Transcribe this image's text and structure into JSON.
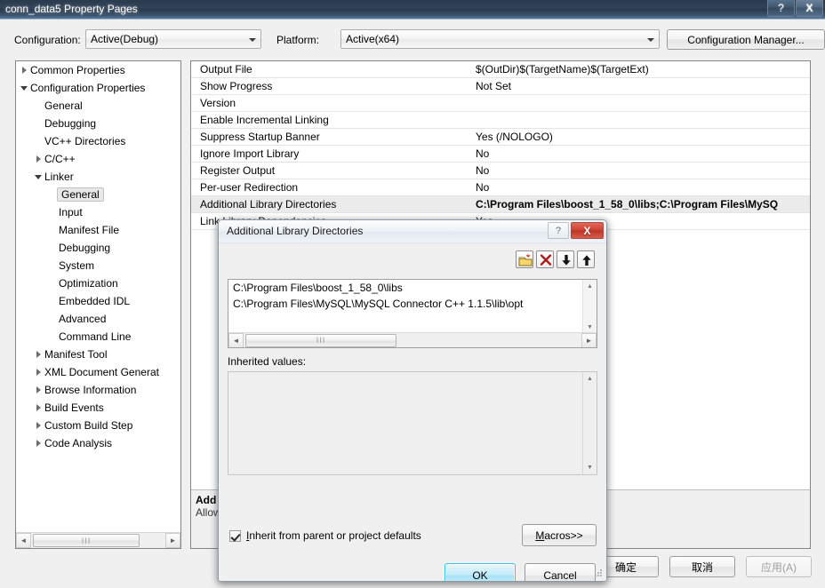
{
  "window": {
    "title": "conn_data5 Property Pages",
    "help_btn": "?",
    "close_btn": "X"
  },
  "configbar": {
    "configuration_label": "Configuration:",
    "configuration_value": "Active(Debug)",
    "platform_label": "Platform:",
    "platform_value": "Active(x64)",
    "config_manager_label": "Configuration Manager..."
  },
  "tree": {
    "nodes": [
      {
        "label": "Common Properties",
        "indent": 0,
        "toggle": "collapsed",
        "selected": false
      },
      {
        "label": "Configuration Properties",
        "indent": 0,
        "toggle": "expanded",
        "selected": false
      },
      {
        "label": "General",
        "indent": 1,
        "toggle": "none",
        "selected": false
      },
      {
        "label": "Debugging",
        "indent": 1,
        "toggle": "none",
        "selected": false
      },
      {
        "label": "VC++ Directories",
        "indent": 1,
        "toggle": "none",
        "selected": false
      },
      {
        "label": "C/C++",
        "indent": 1,
        "toggle": "collapsed",
        "selected": false
      },
      {
        "label": "Linker",
        "indent": 1,
        "toggle": "expanded",
        "selected": false
      },
      {
        "label": "General",
        "indent": 2,
        "toggle": "none",
        "selected": true
      },
      {
        "label": "Input",
        "indent": 2,
        "toggle": "none",
        "selected": false
      },
      {
        "label": "Manifest File",
        "indent": 2,
        "toggle": "none",
        "selected": false
      },
      {
        "label": "Debugging",
        "indent": 2,
        "toggle": "none",
        "selected": false
      },
      {
        "label": "System",
        "indent": 2,
        "toggle": "none",
        "selected": false
      },
      {
        "label": "Optimization",
        "indent": 2,
        "toggle": "none",
        "selected": false
      },
      {
        "label": "Embedded IDL",
        "indent": 2,
        "toggle": "none",
        "selected": false
      },
      {
        "label": "Advanced",
        "indent": 2,
        "toggle": "none",
        "selected": false
      },
      {
        "label": "Command Line",
        "indent": 2,
        "toggle": "none",
        "selected": false
      },
      {
        "label": "Manifest Tool",
        "indent": 1,
        "toggle": "collapsed",
        "selected": false
      },
      {
        "label": "XML Document Generat",
        "indent": 1,
        "toggle": "collapsed",
        "selected": false
      },
      {
        "label": "Browse Information",
        "indent": 1,
        "toggle": "collapsed",
        "selected": false
      },
      {
        "label": "Build Events",
        "indent": 1,
        "toggle": "collapsed",
        "selected": false
      },
      {
        "label": "Custom Build Step",
        "indent": 1,
        "toggle": "collapsed",
        "selected": false
      },
      {
        "label": "Code Analysis",
        "indent": 1,
        "toggle": "collapsed",
        "selected": false
      }
    ],
    "scroll_left_arrow": "◄",
    "scroll_right_arrow": "►",
    "scroll_thumb_grip": "III"
  },
  "grid": {
    "rows": [
      {
        "name": "Output File",
        "value": "$(OutDir)$(TargetName)$(TargetExt)",
        "highlight": false
      },
      {
        "name": "Show Progress",
        "value": "Not Set",
        "highlight": false
      },
      {
        "name": "Version",
        "value": "",
        "highlight": false
      },
      {
        "name": "Enable Incremental Linking",
        "value": "",
        "highlight": false
      },
      {
        "name": "Suppress Startup Banner",
        "value": "Yes (/NOLOGO)",
        "highlight": false
      },
      {
        "name": "Ignore Import Library",
        "value": "No",
        "highlight": false
      },
      {
        "name": "Register Output",
        "value": "No",
        "highlight": false
      },
      {
        "name": "Per-user Redirection",
        "value": "No",
        "highlight": false
      },
      {
        "name": "Additional Library Directories",
        "value": "C:\\Program Files\\boost_1_58_0\\libs;C:\\Program Files\\MySQ",
        "highlight": true
      },
      {
        "name": "Link Library Dependencies",
        "value": "Yes",
        "highlight": false
      }
    ],
    "description_title": "Add",
    "description_body": "Allow"
  },
  "main_buttons": {
    "ok": "确定",
    "cancel": "取消",
    "apply": "应用(A)"
  },
  "dialog": {
    "title": "Additional Library Directories",
    "help_btn": "?",
    "close_btn": "X",
    "toolbar": [
      {
        "name": "new-folder-icon",
        "tooltip": "New Line"
      },
      {
        "name": "delete-x-icon",
        "tooltip": "Delete"
      },
      {
        "name": "arrow-down-icon",
        "tooltip": "Move Down"
      },
      {
        "name": "arrow-up-icon",
        "tooltip": "Move Up"
      }
    ],
    "paths": [
      "C:\\Program Files\\boost_1_58_0\\libs",
      "C:\\Program Files\\MySQL\\MySQL Connector C++ 1.1.5\\lib\\opt"
    ],
    "inherited_label": "Inherited values:",
    "inherited_values": [],
    "inherit_checkbox_label": "Inherit from parent or project defaults",
    "inherit_checkbox_checked": true,
    "macros_label": "Macros>>",
    "ok_label": "OK",
    "cancel_label": "Cancel",
    "scroll_up_arrow": "▲",
    "scroll_down_arrow": "▼",
    "scroll_left_arrow": "◄",
    "scroll_right_arrow": "►",
    "scroll_thumb_grip": "III"
  },
  "colors": {
    "titlebar_dark": "#2b3a4d",
    "close_red": "#cf4335",
    "ok_blue": "#3dc3ea",
    "highlight_row": "#ebebeb"
  }
}
